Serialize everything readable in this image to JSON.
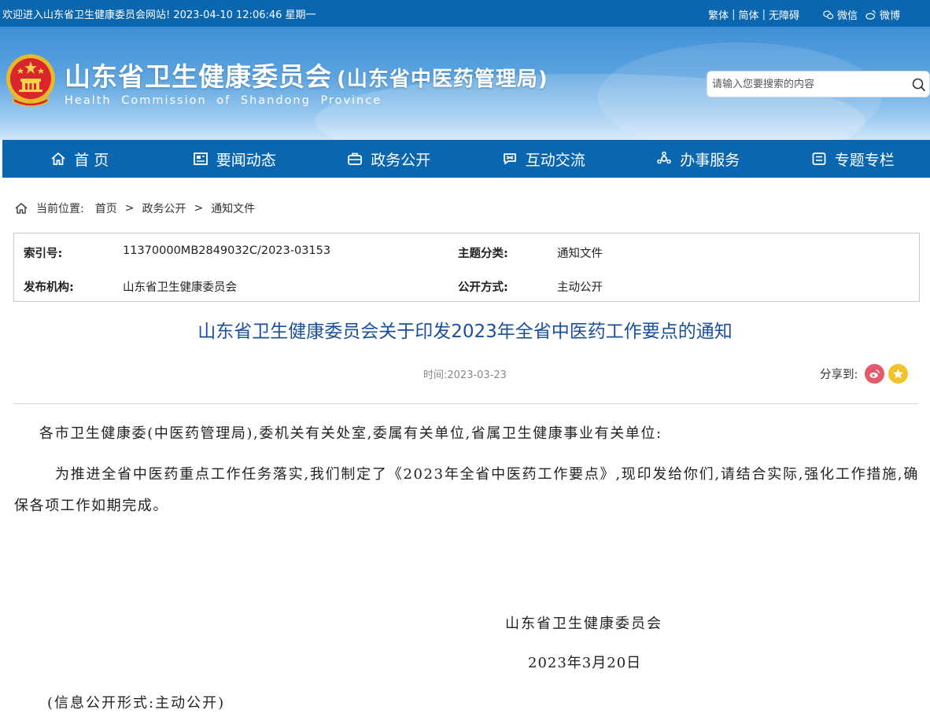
{
  "topbar": {
    "welcome": "欢迎进入山东省卫生健康委员会网站! 2023-04-10 12:06:46 星期一",
    "traditional": "繁体",
    "simplified": "简体",
    "accessible": "无障碍",
    "sep": "|",
    "wechat": "微信",
    "weibo": "微博"
  },
  "header": {
    "title": "山东省卫生健康委员会",
    "subtitle": "(山东省中医药管理局)",
    "english": "Health Commission of Shandong Province",
    "search_placeholder": "请输入您要搜索的内容"
  },
  "nav": [
    {
      "label": "首 页",
      "icon": "home-icon"
    },
    {
      "label": "要闻动态",
      "icon": "news-icon"
    },
    {
      "label": "政务公开",
      "icon": "briefcase-icon"
    },
    {
      "label": "互动交流",
      "icon": "interaction-icon"
    },
    {
      "label": "办事服务",
      "icon": "service-icon"
    },
    {
      "label": "专题专栏",
      "icon": "column-icon"
    }
  ],
  "breadcrumb": {
    "label": "当前位置:",
    "items": [
      "首页",
      "政务公开",
      "通知文件"
    ],
    "sep": ">"
  },
  "info": {
    "index_label": "索引号:",
    "index_value": "11370000MB2849032C/2023-03153",
    "topic_label": "主题分类:",
    "topic_value": "通知文件",
    "org_label": "发布机构:",
    "org_value": "山东省卫生健康委员会",
    "mode_label": "公开方式:",
    "mode_value": "主动公开"
  },
  "article": {
    "title": "山东省卫生健康委员会关于印发2023年全省中医药工作要点的通知",
    "time_label": "时间:",
    "time_value": "2023-03-23",
    "share_label": "分享到:",
    "p1": "各市卫生健康委(中医药管理局),委机关有关处室,委属有关单位,省属卫生健康事业有关单位:",
    "p2": "为推进全省中医药重点工作任务落实,我们制定了《2023年全省中医药工作要点》,现印发给你们,请结合实际,强化工作措施,确保各项工作如期完成。",
    "signature": "山东省卫生健康委员会",
    "date": "2023年3月20日",
    "disclosure": "(信息公开形式:主动公开)"
  },
  "colors": {
    "brand_blue": "#0b66b0",
    "title_blue": "#1a4f9c",
    "weibo_red": "#e5596a",
    "star_yellow": "#f3c22b"
  }
}
